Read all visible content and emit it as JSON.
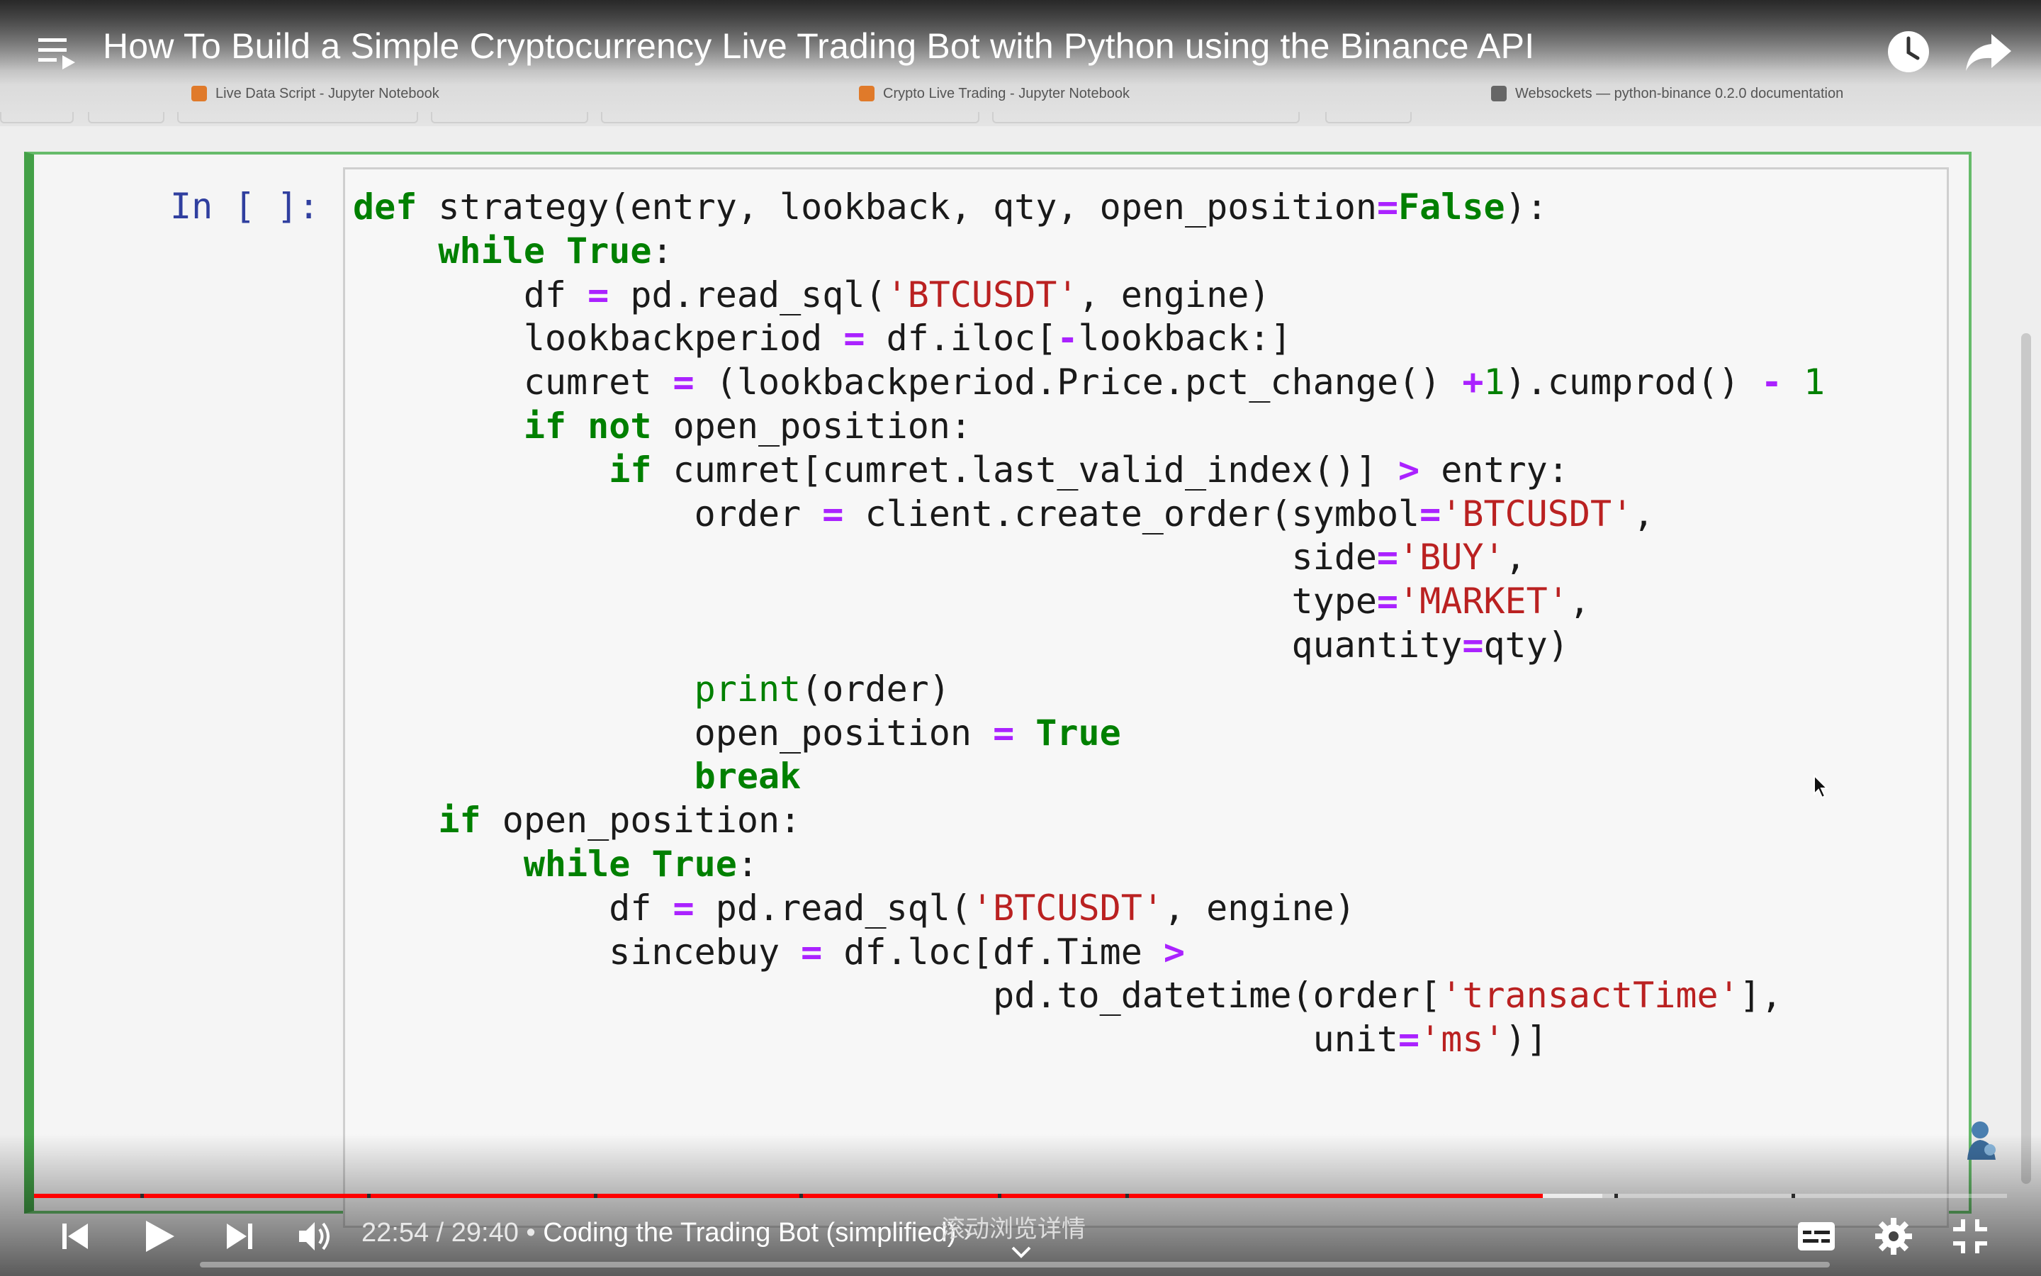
{
  "video": {
    "title": "How To Build a Simple Cryptocurrency Live Trading Bot with Python using the Binance API",
    "current_time": "22:54",
    "duration": "29:40",
    "time_separator": " / ",
    "chapter_separator": " • ",
    "chapter": "Coding the Trading Bot (simplified)",
    "chapter_chevron": "›",
    "scroll_hint": "滚动浏览详情",
    "progress_fraction": 0.7648
  },
  "browser": {
    "tabs": [
      {
        "label": "Live Data Script - Jupyter Notebook",
        "icon": "jupyter-icon"
      },
      {
        "label": "Crypto Live Trading - Jupyter Notebook",
        "icon": "jupyter-icon"
      },
      {
        "label": "Websockets — python-binance 0.2.0 documentation",
        "icon": "doc-icon"
      }
    ]
  },
  "notebook": {
    "prompt": "In [ ]:",
    "code_lines": [
      "def strategy(entry, lookback, qty, open_position=False):",
      "    while True:",
      "        df = pd.read_sql('BTCUSDT', engine)",
      "        lookbackperiod = df.iloc[-lookback:]",
      "        cumret = (lookbackperiod.Price.pct_change() +1).cumprod() - 1",
      "        if not open_position:",
      "            if cumret[cumret.last_valid_index()] > entry:",
      "                order = client.create_order(symbol='BTCUSDT',",
      "                                            side='BUY',",
      "                                            type='MARKET',",
      "                                            quantity=qty)",
      "                print(order)",
      "                open_position = True",
      "                break",
      "    if open_position:",
      "        while True:",
      "            df = pd.read_sql('BTCUSDT', engine)",
      "            sincebuy = df.loc[df.Time >",
      "                              pd.to_datetime(order['transactTime'],",
      "                                             unit='ms')]"
    ]
  },
  "icons": {
    "playlist": "playlist-icon",
    "watch_later": "clock-icon",
    "share": "share-icon",
    "prev": "previous-icon",
    "play": "play-icon",
    "next": "next-icon",
    "volume": "volume-icon",
    "subtitles": "subtitles-icon",
    "settings": "gear-icon",
    "exit_fullscreen": "exit-fullscreen-icon"
  },
  "colors": {
    "progress_played": "#ff0000",
    "cell_border": "#43a047",
    "keyword": "#008000",
    "string": "#ba2121",
    "operator": "#aa22ff",
    "prompt": "#303f9f"
  }
}
